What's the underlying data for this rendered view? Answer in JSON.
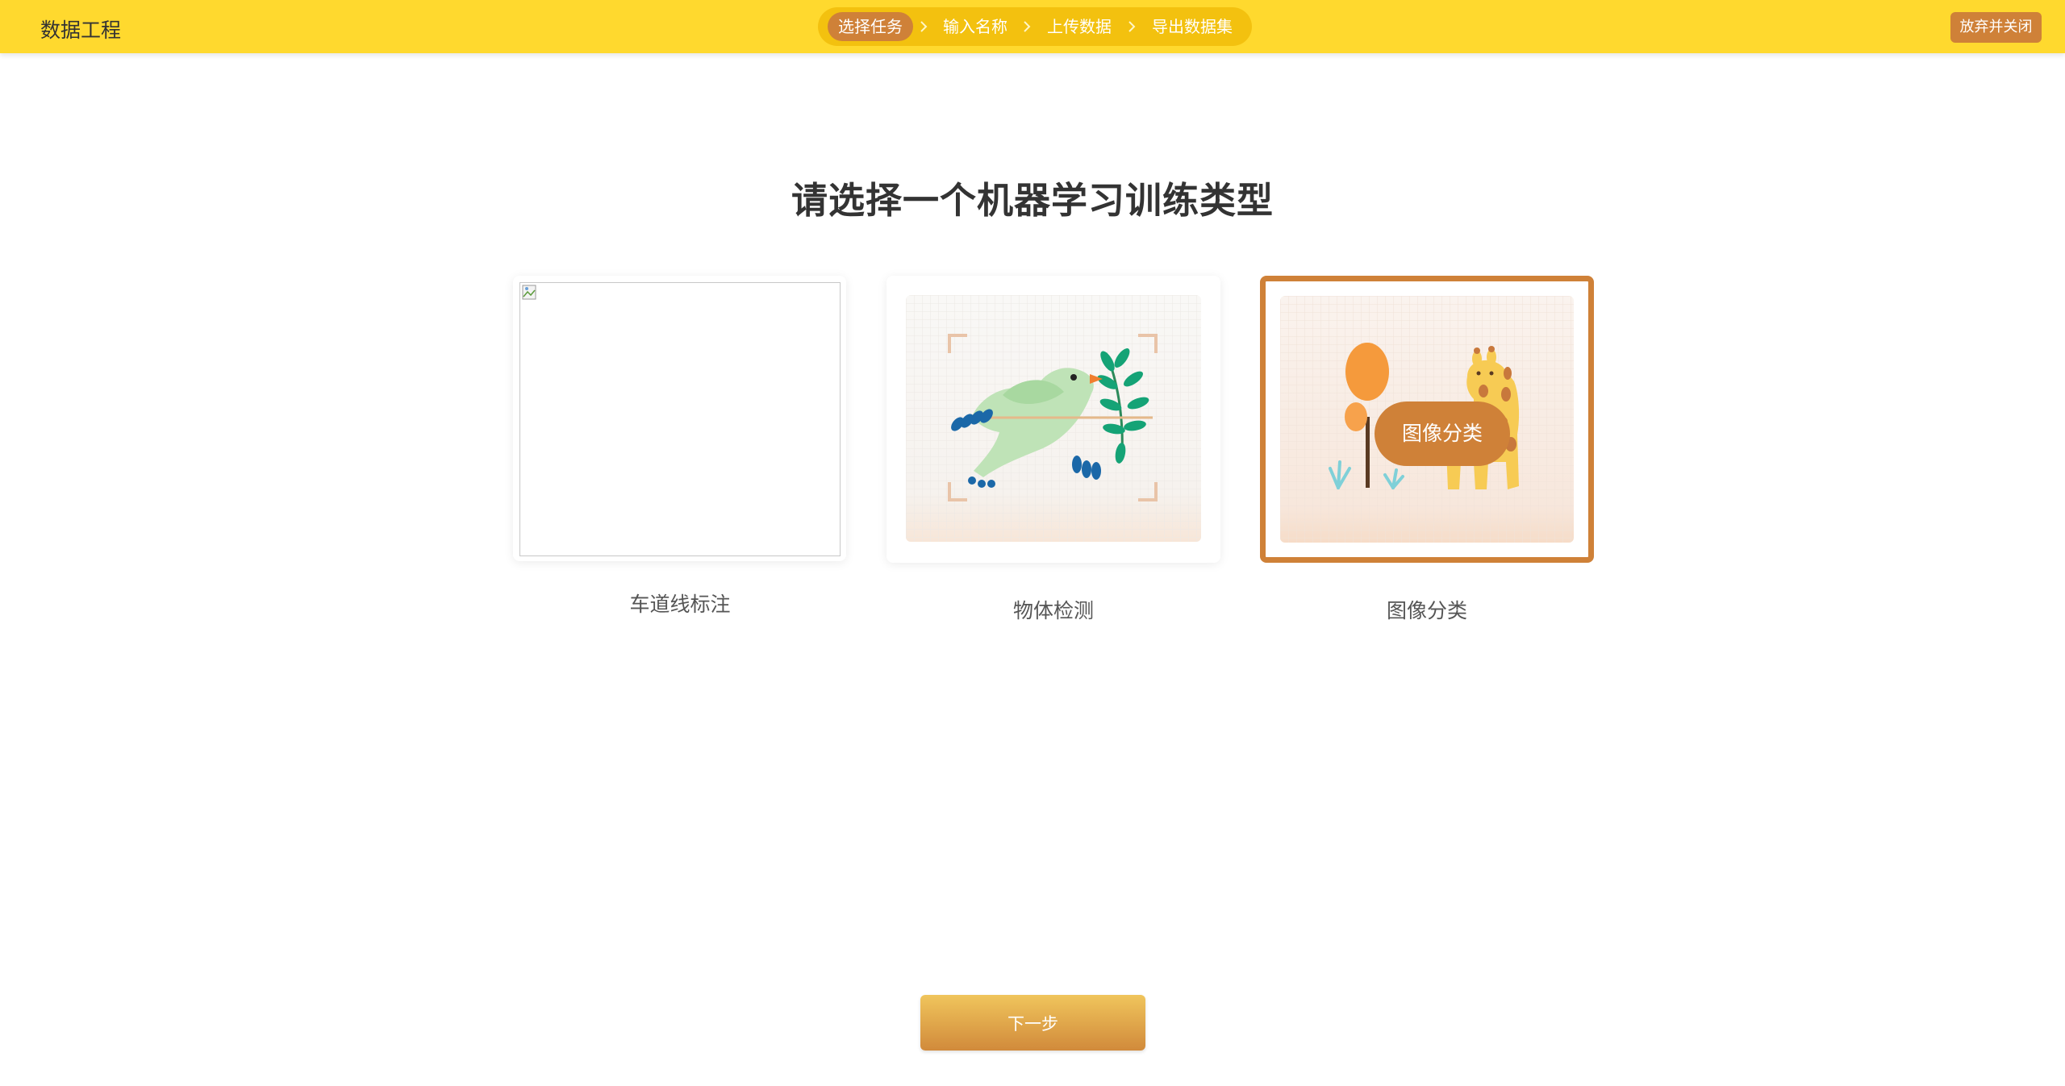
{
  "app": {
    "title": "数据工程"
  },
  "steps": [
    {
      "label": "选择任务",
      "active": true
    },
    {
      "label": "输入名称",
      "active": false
    },
    {
      "label": "上传数据",
      "active": false
    },
    {
      "label": "导出数据集",
      "active": false
    }
  ],
  "header": {
    "quit_label": "放弃并关闭"
  },
  "main": {
    "heading": "请选择一个机器学习训练类型",
    "cards": [
      {
        "label": "车道线标注",
        "selected": false
      },
      {
        "label": "物体检测",
        "selected": false
      },
      {
        "label": "图像分类",
        "selected": true,
        "overlay_label": "图像分类"
      }
    ]
  },
  "footer": {
    "next_label": "下一步"
  },
  "colors": {
    "topbar": "#ffd92e",
    "stepper_track": "#f3c10f",
    "accent": "#cf8138",
    "heading_text": "#333333"
  },
  "icons": {
    "chevron": "chevron-right-icon",
    "broken_image": "broken-image-icon"
  }
}
